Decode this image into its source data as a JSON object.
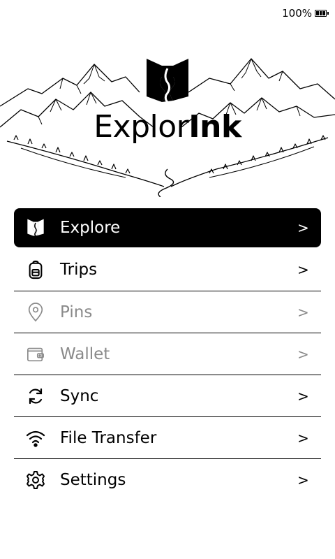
{
  "status": {
    "battery_percent": "100%",
    "battery_level": 1.0
  },
  "brand": {
    "name_part1": "Explor",
    "name_part2": "Ink"
  },
  "menu": {
    "items": [
      {
        "label": "Explore",
        "icon": "explorink-logo-icon",
        "active": true,
        "enabled": true
      },
      {
        "label": "Trips",
        "icon": "backpack-icon",
        "active": false,
        "enabled": true
      },
      {
        "label": "Pins",
        "icon": "map-pin-icon",
        "active": false,
        "enabled": false
      },
      {
        "label": "Wallet",
        "icon": "wallet-icon",
        "active": false,
        "enabled": false
      },
      {
        "label": "Sync",
        "icon": "sync-icon",
        "active": false,
        "enabled": true
      },
      {
        "label": "File Transfer",
        "icon": "wifi-icon",
        "active": false,
        "enabled": true
      },
      {
        "label": "Settings",
        "icon": "gear-icon",
        "active": false,
        "enabled": true
      }
    ],
    "chevron": ">"
  },
  "colors": {
    "background": "#ffffff",
    "foreground": "#000000",
    "disabled": "#8a8a8a"
  }
}
